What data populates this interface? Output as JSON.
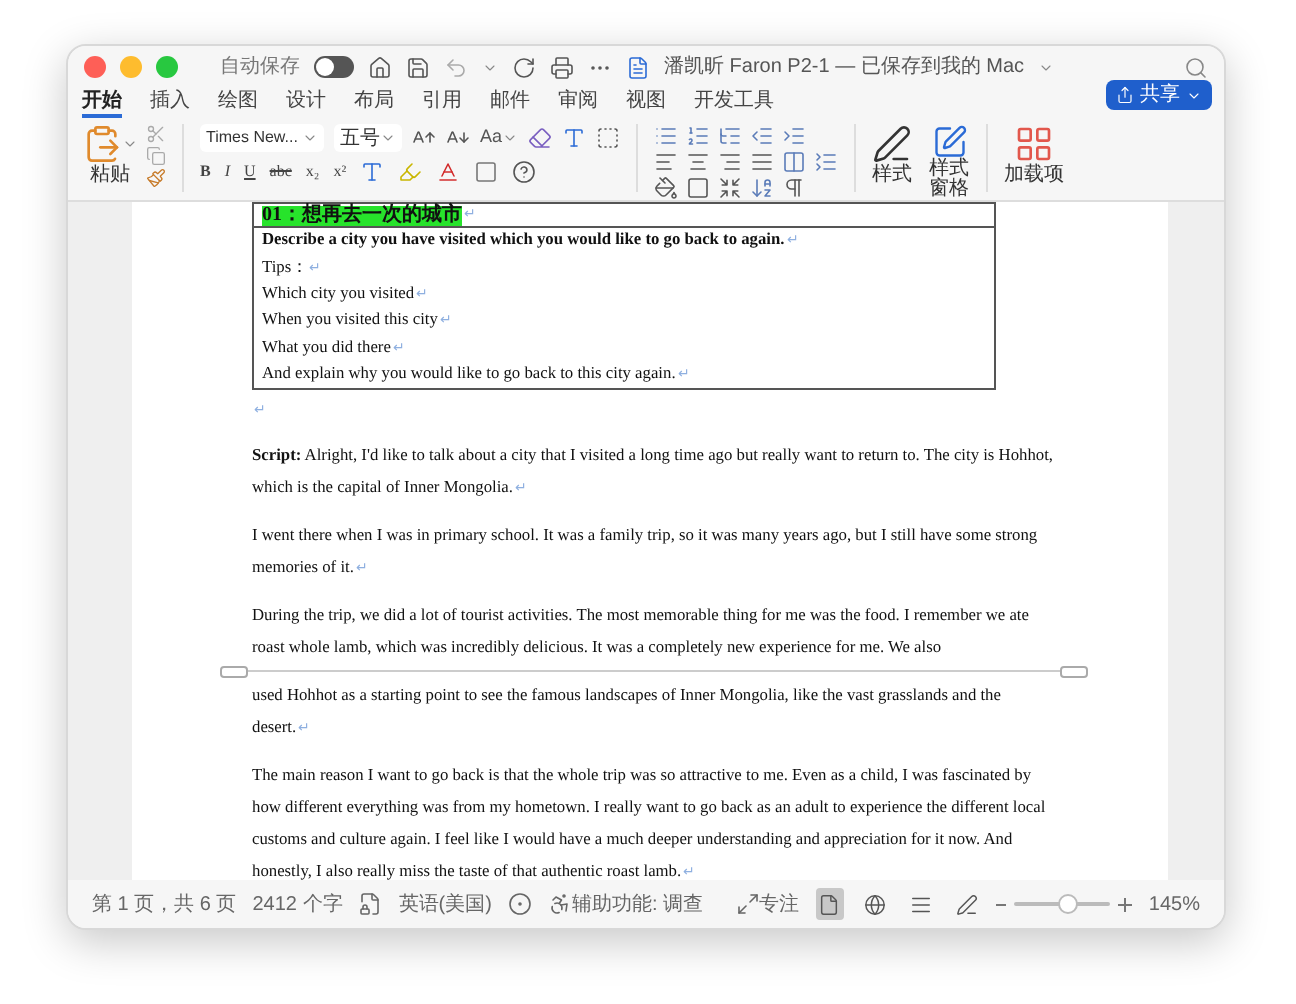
{
  "window": {
    "title": "潘凯昕 Faron P2-1 — 已保存到我的 Mac",
    "autosave": {
      "label": "自动保存",
      "on": false
    }
  },
  "tabs": [
    {
      "label": "开始",
      "selected": true
    },
    {
      "label": "插入",
      "selected": false
    },
    {
      "label": "绘图",
      "selected": false
    },
    {
      "label": "设计",
      "selected": false
    },
    {
      "label": "布局",
      "selected": false
    },
    {
      "label": "引用",
      "selected": false
    },
    {
      "label": "邮件",
      "selected": false
    },
    {
      "label": "审阅",
      "selected": false
    },
    {
      "label": "视图",
      "selected": false
    },
    {
      "label": "开发工具",
      "selected": false
    }
  ],
  "share_button": "共享",
  "ribbon": {
    "paste": "粘贴",
    "font_name": "Times New...",
    "font_size": "五号",
    "change_case": "Aa",
    "format_buttons": [
      "B",
      "I",
      "U",
      "abc",
      "x₂",
      "x²"
    ],
    "styles": "样式",
    "styles_pane": "样式窗格",
    "addins": "加载项"
  },
  "document": {
    "table": [
      {
        "kind": "heading",
        "text": "01：想再去一次的城市",
        "mark": "↵"
      },
      {
        "kind": "bold",
        "text": "Describe a city you have visited which you would like to go back to again.",
        "mark": "↵"
      },
      {
        "kind": "plain",
        "text": "Tips：",
        "mark": "↵"
      },
      {
        "kind": "plain",
        "text": "Which city you visited",
        "mark": "↵"
      },
      {
        "kind": "plain",
        "text": "When you visited this city",
        "mark": "↵"
      },
      {
        "kind": "plain",
        "text": "What you did there",
        "mark": "↵"
      },
      {
        "kind": "plain",
        "text": "And explain why you would like to go back to this city again.",
        "mark": "↵"
      }
    ],
    "paragraphs": [
      {
        "kind": "empty",
        "mark": "↵"
      },
      {
        "kind": "paragraph",
        "label": "Script:",
        "text": "Alright, I'd like to talk about a city that I visited a long time ago but really want to return to. The city is Hohhot, which is the capital of Inner Mongolia.",
        "mark": "↵"
      },
      {
        "kind": "paragraph",
        "text": "I went there when I was in primary school. It was a family trip, so it was many years ago, but I still have some strong memories of it.",
        "mark": "↵"
      },
      {
        "kind": "paragraph",
        "text": "During the trip, we did a lot of tourist activities. The most memorable thing for me was the food. I remember we ate roast whole lamb, which was incredibly delicious. It was a completely new experience for me. We also"
      },
      {
        "kind": "page_break"
      },
      {
        "kind": "paragraph",
        "text": "used Hohhot as a starting point to see the famous landscapes of Inner Mongolia, like the vast grasslands and the desert.",
        "mark": "↵"
      },
      {
        "kind": "paragraph",
        "text": "The main reason I want to go back is that the whole trip was so attractive to me. Even as a child, I was fascinated by how different everything was from my hometown. I really want to go back as an adult to experience the different local customs and culture again. I feel like I would have a much deeper understanding and appreciation for it now. And honestly, I also really miss the taste of that authentic roast lamb.",
        "mark": "↵"
      }
    ]
  },
  "status_bar": {
    "page": "第 1 页，共 6 页",
    "words": "2412 个字",
    "language": "英语(美国)",
    "accessibility": "辅助功能: 调查",
    "focus": "专注",
    "views": [
      {
        "kind": "print",
        "selected": true
      },
      {
        "kind": "web",
        "selected": false
      },
      {
        "kind": "outline",
        "selected": false
      },
      {
        "kind": "draft",
        "selected": false
      }
    ],
    "zoom": {
      "level": 0.55
    },
    "zoom_text": "145%"
  }
}
